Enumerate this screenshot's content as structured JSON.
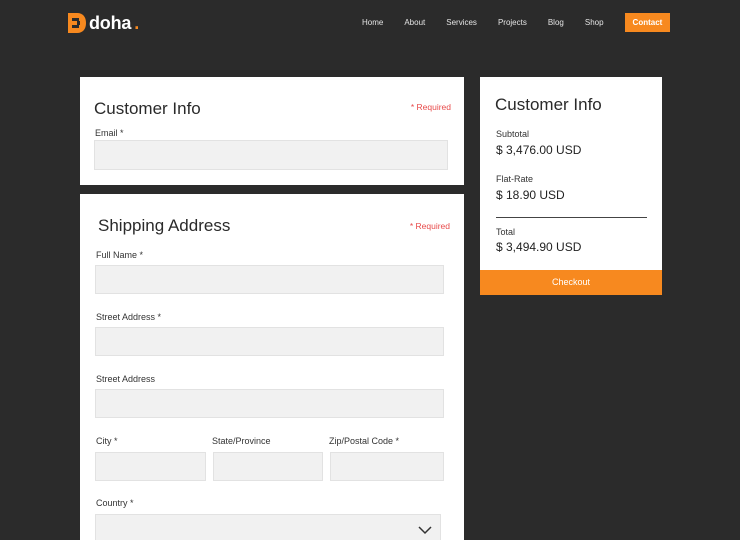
{
  "header": {
    "brand_name": "doha",
    "brand_dot": ".",
    "nav": [
      "Home",
      "About",
      "Services",
      "Projects",
      "Blog",
      "Shop"
    ],
    "contact_label": "Contact"
  },
  "customer_info": {
    "title": "Customer Info",
    "required_note": "* Required",
    "email_label": "Email *",
    "email_value": ""
  },
  "shipping": {
    "title": "Shipping Address",
    "required_note": "* Required",
    "full_name_label": "Full Name *",
    "street1_label": "Street Address *",
    "street2_label": "Street Address",
    "city_label": "City *",
    "state_label": "State/Province",
    "zip_label": "Zip/Postal Code *",
    "country_label": "Country *",
    "country_value": ""
  },
  "summary": {
    "title": "Customer Info",
    "subtotal_label": "Subtotal",
    "subtotal_value": "$ 3,476.00 USD",
    "shipping_label": "Flat-Rate",
    "shipping_value": "$ 18.90 USD",
    "total_label": "Total",
    "total_value": "$ 3,494.90 USD",
    "checkout_label": "Checkout"
  },
  "colors": {
    "accent": "#f7891f",
    "background": "#2b2b2b",
    "required": "#e84b4b"
  }
}
